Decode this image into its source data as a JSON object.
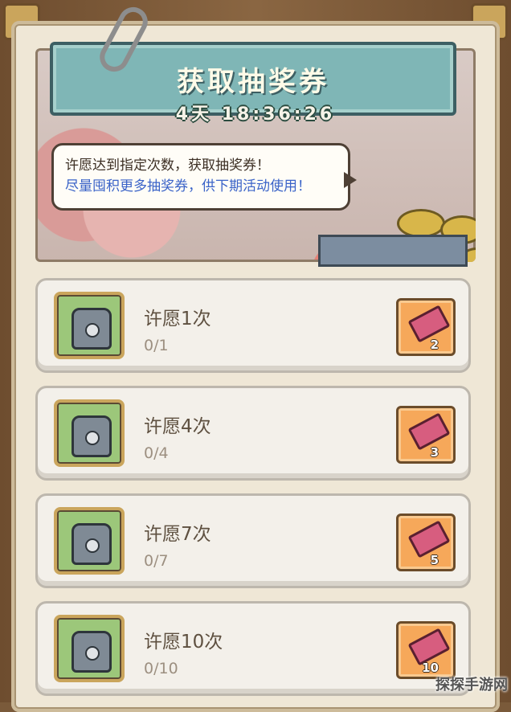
{
  "header": {
    "title": "获取抽奖券",
    "countdown": "4天 18:36:26"
  },
  "speech": {
    "line1": "许愿达到指定次数，获取抽奖券！",
    "line2": "尽量囤积更多抽奖券，供下期活动使用！"
  },
  "tasks": [
    {
      "title": "许愿1次",
      "progress": "0/1",
      "reward_count": "2",
      "reward_icon": "lottery-ticket-icon"
    },
    {
      "title": "许愿4次",
      "progress": "0/4",
      "reward_count": "3",
      "reward_icon": "lottery-ticket-icon"
    },
    {
      "title": "许愿7次",
      "progress": "0/7",
      "reward_count": "5",
      "reward_icon": "lottery-ticket-icon"
    },
    {
      "title": "许愿10次",
      "progress": "0/10",
      "reward_count": "10",
      "reward_icon": "lottery-ticket-icon"
    }
  ],
  "watermark": "探探手游网",
  "colors": {
    "title_banner": "#7fb6b6",
    "highlight_text": "#3a63c8",
    "reward_bg": "#f6a85a",
    "task_icon_bg": "#9cc77a"
  }
}
